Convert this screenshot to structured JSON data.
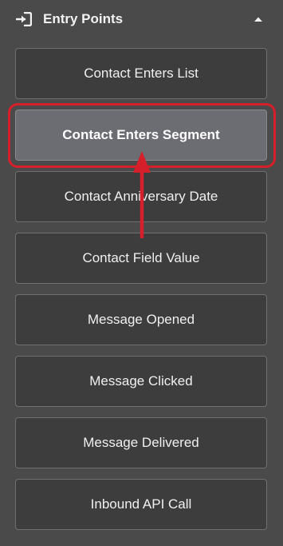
{
  "header": {
    "title": "Entry Points",
    "icon": "sign-in-icon",
    "collapse_icon": "caret-up-icon"
  },
  "entry_points": [
    {
      "label": "Contact Enters List",
      "selected": false
    },
    {
      "label": "Contact Enters Segment",
      "selected": true
    },
    {
      "label": "Contact Anniversary Date",
      "selected": false
    },
    {
      "label": "Contact Field Value",
      "selected": false
    },
    {
      "label": "Message Opened",
      "selected": false
    },
    {
      "label": "Message Clicked",
      "selected": false
    },
    {
      "label": "Message Delivered",
      "selected": false
    },
    {
      "label": "Inbound API Call",
      "selected": false
    }
  ],
  "annotation": {
    "highlight_color": "#d51f2a",
    "arrow_icon": "arrow-up-annotation"
  },
  "colors": {
    "panel_bg": "#4a4a4a",
    "button_bg": "#3d3d3d",
    "button_selected_bg": "#6c6c73",
    "text": "#f0f0f0"
  }
}
